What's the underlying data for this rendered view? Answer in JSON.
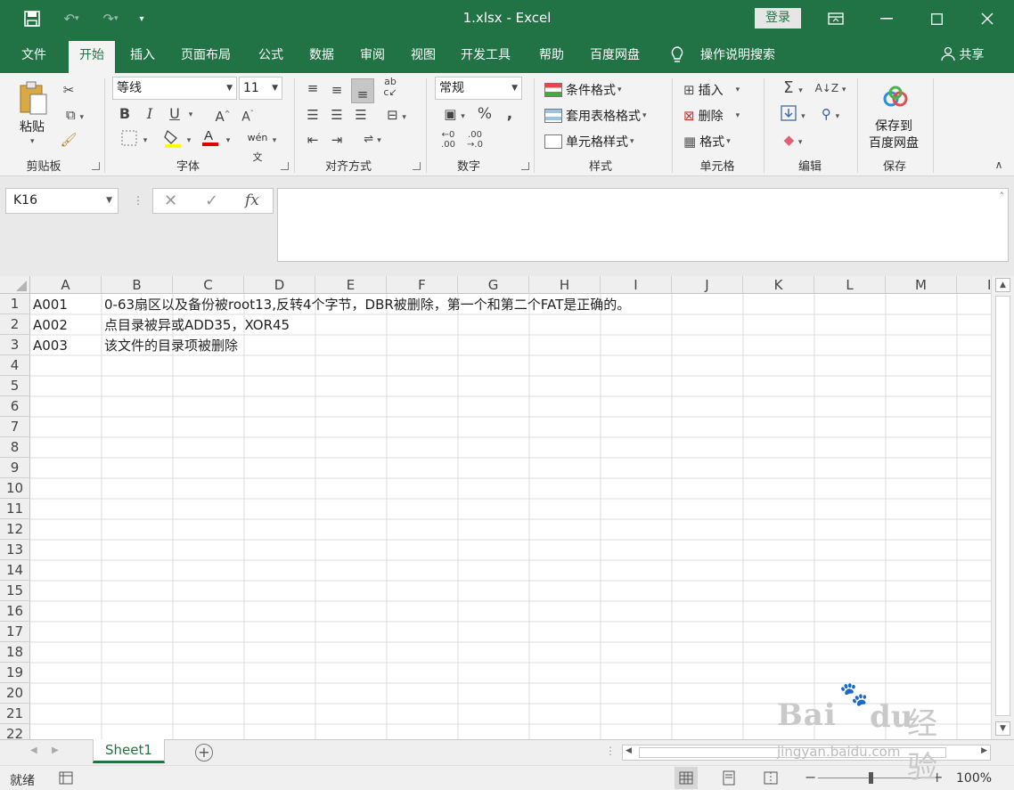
{
  "window": {
    "title": "1.xlsx  -  Excel",
    "login": "登录",
    "share": "共享"
  },
  "tabs": [
    "文件",
    "开始",
    "插入",
    "页面布局",
    "公式",
    "数据",
    "审阅",
    "视图",
    "开发工具",
    "帮助",
    "百度网盘",
    "操作说明搜索"
  ],
  "ribbon": {
    "clipboard": {
      "label": "剪贴板",
      "paste": "粘贴"
    },
    "font": {
      "label": "字体",
      "font_name": "等线",
      "font_size": "11",
      "bold": "B",
      "italic": "I",
      "underline": "U"
    },
    "alignment": {
      "label": "对齐方式"
    },
    "number": {
      "label": "数字",
      "format": "常规",
      "percent": "%"
    },
    "styles": {
      "label": "样式",
      "conditional": "条件格式",
      "table": "套用表格格式",
      "cell_styles": "单元格样式"
    },
    "cells": {
      "label": "单元格",
      "insert": "插入",
      "delete": "删除",
      "format": "格式"
    },
    "editing": {
      "label": "编辑"
    },
    "save": {
      "label": "保存",
      "line1": "保存到",
      "line2": "百度网盘"
    }
  },
  "formula_bar": {
    "name_box": "K16",
    "fx": "fx",
    "content": ""
  },
  "grid": {
    "columns": [
      "A",
      "B",
      "C",
      "D",
      "E",
      "F",
      "G",
      "H",
      "I",
      "J",
      "K",
      "L",
      "M",
      "I"
    ],
    "rows": [
      "1",
      "2",
      "3",
      "4",
      "5",
      "6",
      "7",
      "8",
      "9",
      "10",
      "11",
      "12",
      "13",
      "14",
      "15",
      "16",
      "17",
      "18",
      "19",
      "20",
      "21",
      "22"
    ],
    "cells": [
      {
        "a": "A001",
        "b": "0-63扇区以及备份被root13,反转4个字节，DBR被删除，第一个和第二个FAT是正确的。"
      },
      {
        "a": "A002",
        "b": "点目录被异或ADD35，XOR45"
      },
      {
        "a": "A003",
        "b": "该文件的目录项被删除"
      }
    ]
  },
  "sheets": {
    "active": "Sheet1"
  },
  "status": {
    "ready": "就绪",
    "zoom": "100%"
  },
  "watermark": {
    "text1": "Bai",
    "text2": "经验",
    "text3": "jingyan.baidu.com"
  }
}
